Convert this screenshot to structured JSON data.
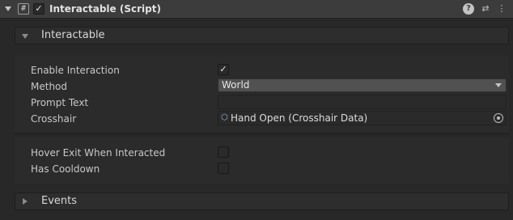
{
  "component": {
    "title": "Interactable (Script)",
    "enabled_mark": "✓",
    "script_icon": "#",
    "icons": {
      "help": "?",
      "presets": "⇄",
      "menu": "⋮"
    }
  },
  "sections": {
    "interactable": {
      "label": "Interactable",
      "expanded": true
    },
    "events": {
      "label": "Events",
      "expanded": false
    }
  },
  "fields": {
    "enable_interaction": {
      "label": "Enable Interaction",
      "checked": true,
      "mark": "✓"
    },
    "method": {
      "label": "Method",
      "value": "World"
    },
    "prompt_text": {
      "label": "Prompt Text",
      "value": ""
    },
    "crosshair": {
      "label": "Crosshair",
      "value": "Hand Open (Crosshair Data)",
      "icon": "cube-icon"
    },
    "hover_exit": {
      "label": "Hover Exit When Interacted",
      "checked": false
    },
    "has_cooldown": {
      "label": "Has Cooldown",
      "checked": false
    }
  },
  "colors": {
    "background": "#282828",
    "header": "#3c3c3c",
    "dropdown": "#515151"
  }
}
